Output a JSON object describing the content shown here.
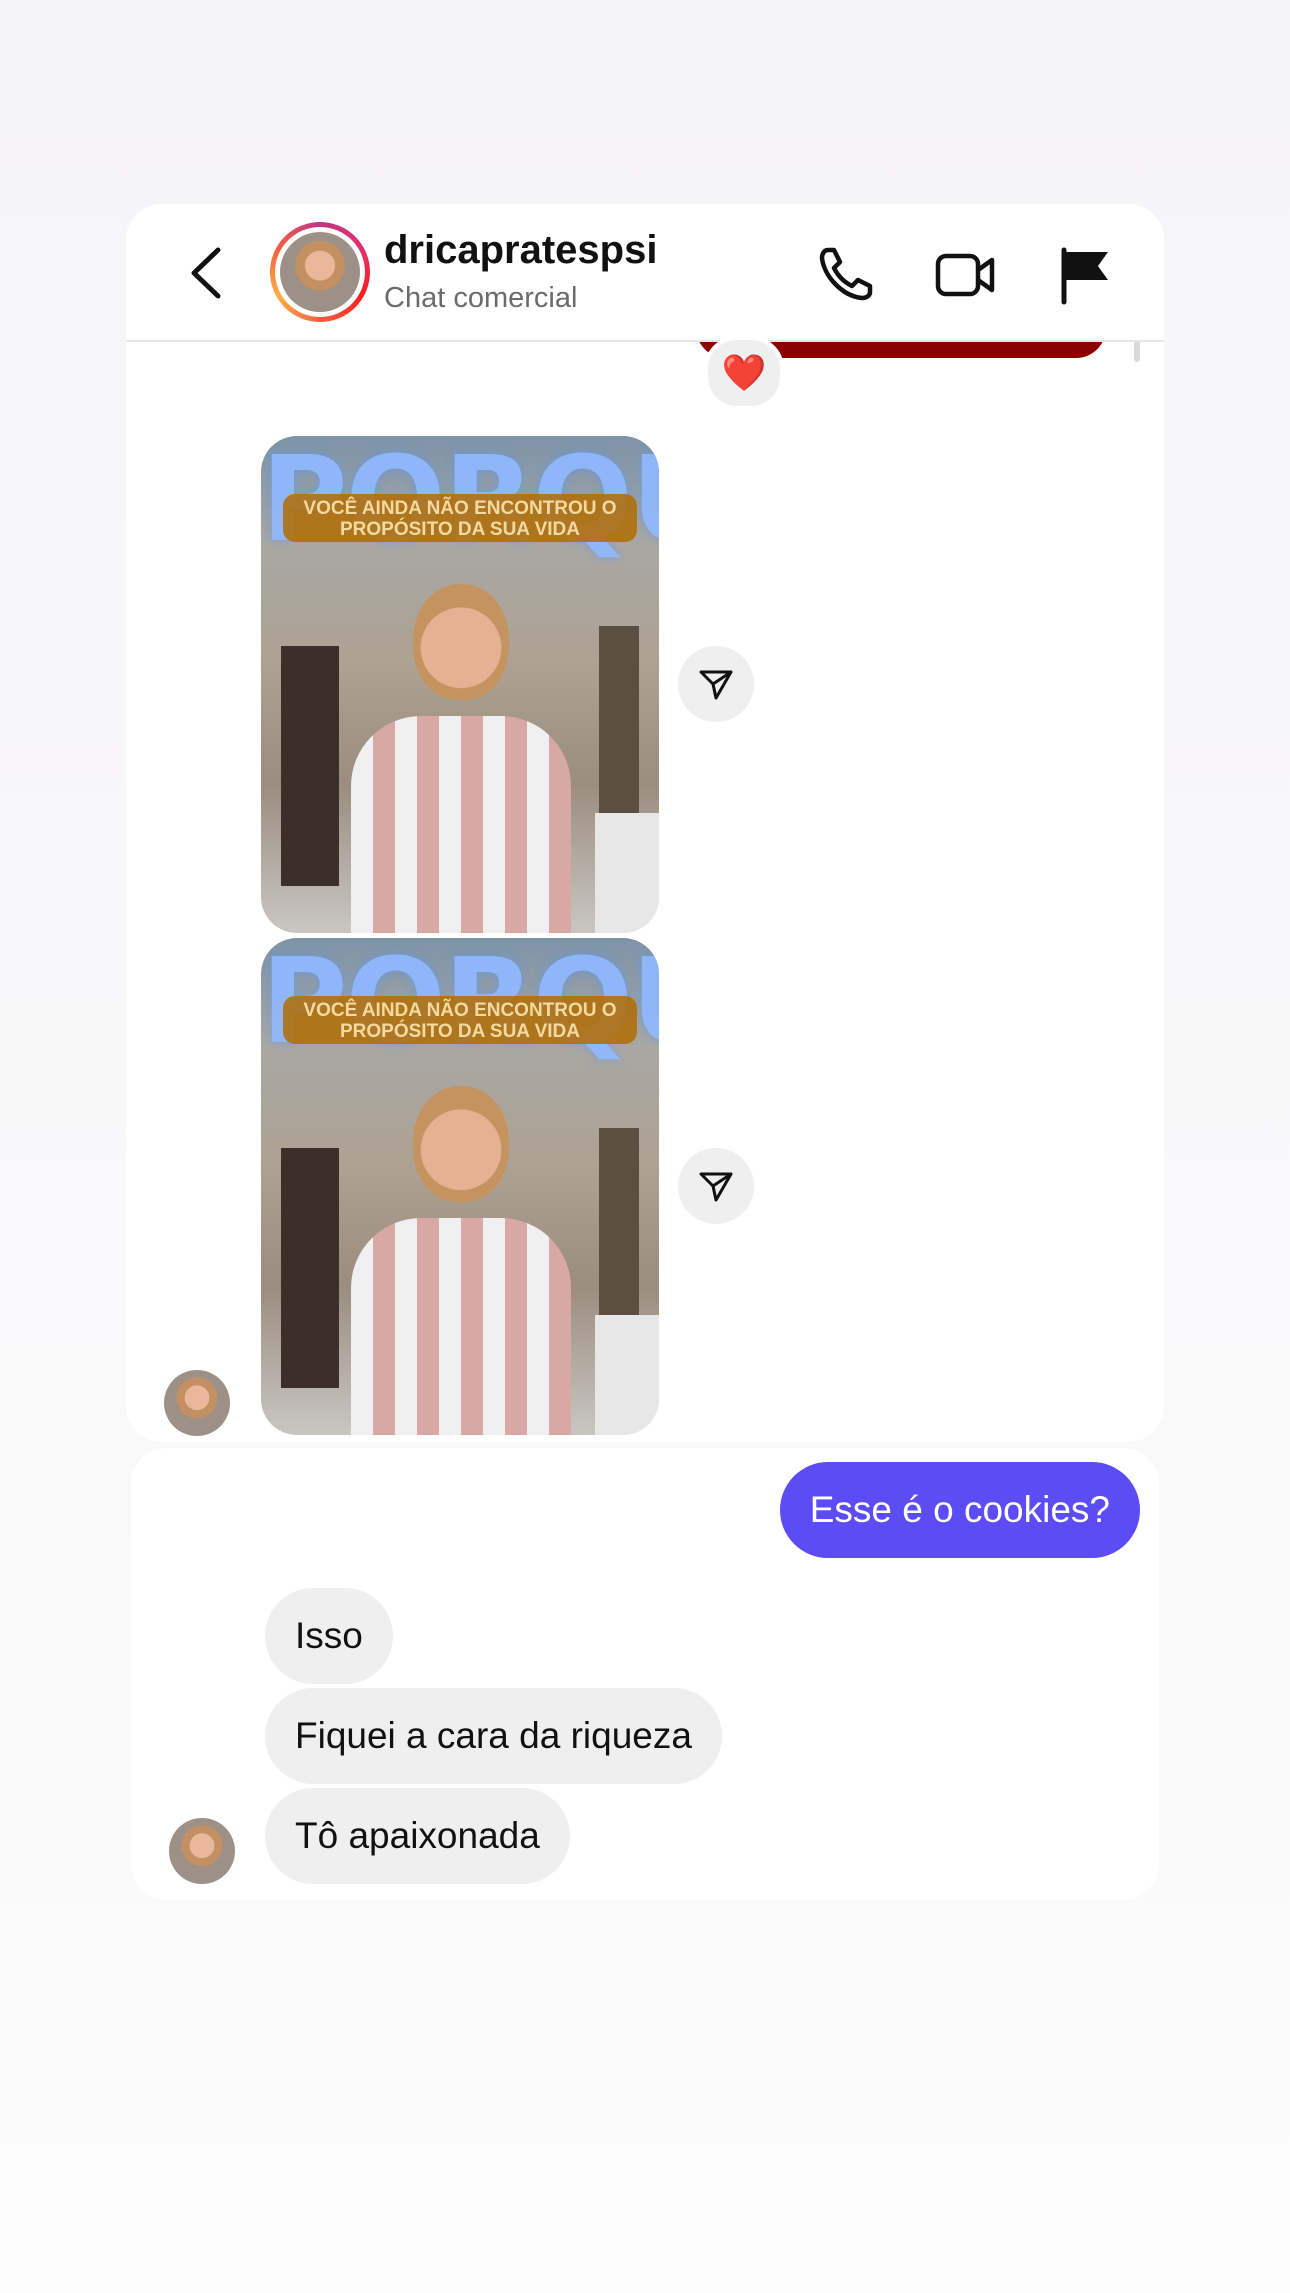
{
  "header": {
    "username": "dricapratespsi",
    "subtitle": "Chat comercial"
  },
  "media": [
    {
      "overlay_title": "PORQUE",
      "overlay_banner": "VOCÊ AINDA NÃO ENCONTROU O PROPÓSITO DA SUA VIDA"
    },
    {
      "overlay_title": "PORQUE",
      "overlay_banner": "VOCÊ AINDA NÃO ENCONTROU O PROPÓSITO DA SUA VIDA"
    }
  ],
  "reaction": "❤️",
  "messages": {
    "sent": "Esse é o cookies?",
    "received": [
      "Isso",
      "Fiquei a cara da riqueza",
      "Tô apaixonada"
    ]
  },
  "colors": {
    "sent_bubble": "#5b4cf5",
    "received_bubble": "#efefef",
    "reaction_stub": "#8b0000"
  }
}
